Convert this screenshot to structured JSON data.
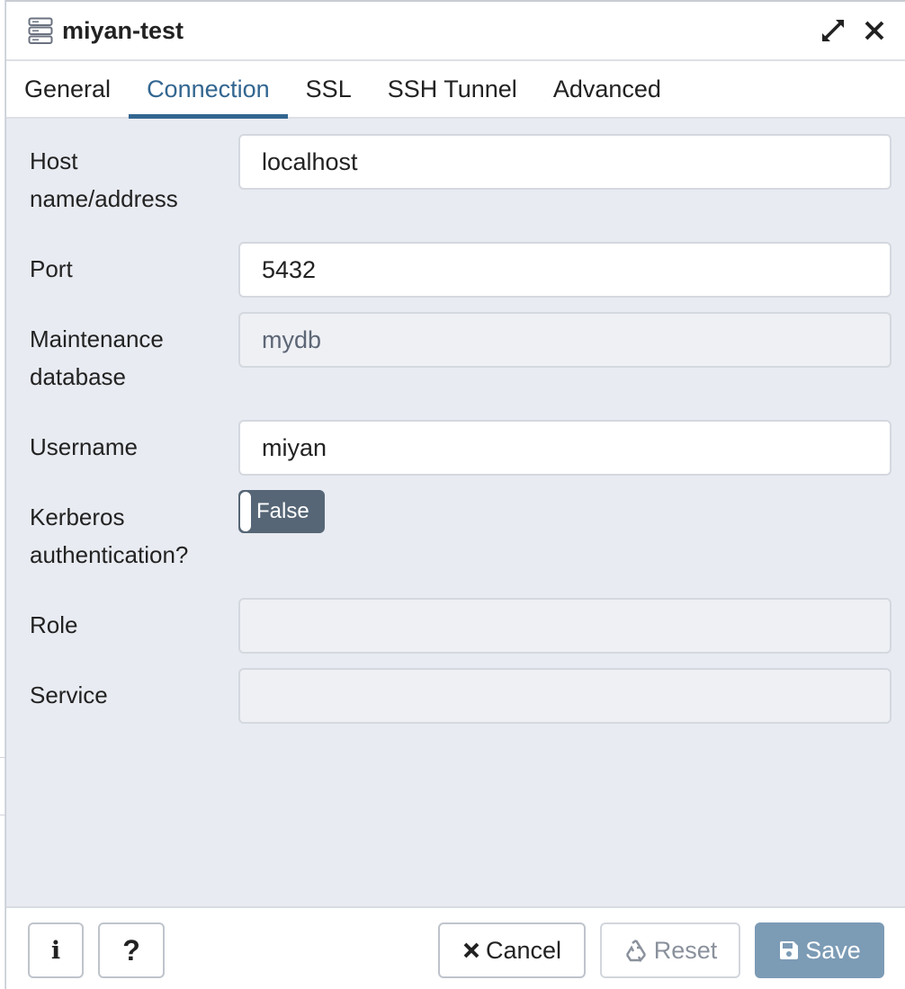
{
  "dialog": {
    "title": "miyan-test"
  },
  "tabs": [
    {
      "label": "General",
      "active": false
    },
    {
      "label": "Connection",
      "active": true
    },
    {
      "label": "SSL",
      "active": false
    },
    {
      "label": "SSH Tunnel",
      "active": false
    },
    {
      "label": "Advanced",
      "active": false
    }
  ],
  "form": {
    "host": {
      "label_line1": "Host",
      "label_line2": "name/address",
      "value": "localhost"
    },
    "port": {
      "label": "Port",
      "value": "5432"
    },
    "maintenance_db": {
      "label_line1": "Maintenance",
      "label_line2": "database",
      "value": "mydb",
      "disabled": true
    },
    "username": {
      "label": "Username",
      "value": "miyan"
    },
    "kerberos": {
      "label_line1": "Kerberos",
      "label_line2": "authentication?",
      "value": "False"
    },
    "role": {
      "label": "Role",
      "value": ""
    },
    "service": {
      "label": "Service",
      "value": ""
    }
  },
  "footer": {
    "info_label": "i",
    "help_label": "?",
    "cancel_label": "Cancel",
    "reset_label": "Reset",
    "save_label": "Save"
  },
  "colors": {
    "accent": "#326690",
    "body_bg": "#e8ebf1",
    "toggle_bg": "#566676",
    "save_bg": "#7c9bb5"
  },
  "icons": {
    "title": "server-icon",
    "maximize": "expand-icon",
    "close": "close-icon",
    "cancel": "x-icon",
    "reset": "recycle-icon",
    "save": "floppy-disk-icon"
  }
}
